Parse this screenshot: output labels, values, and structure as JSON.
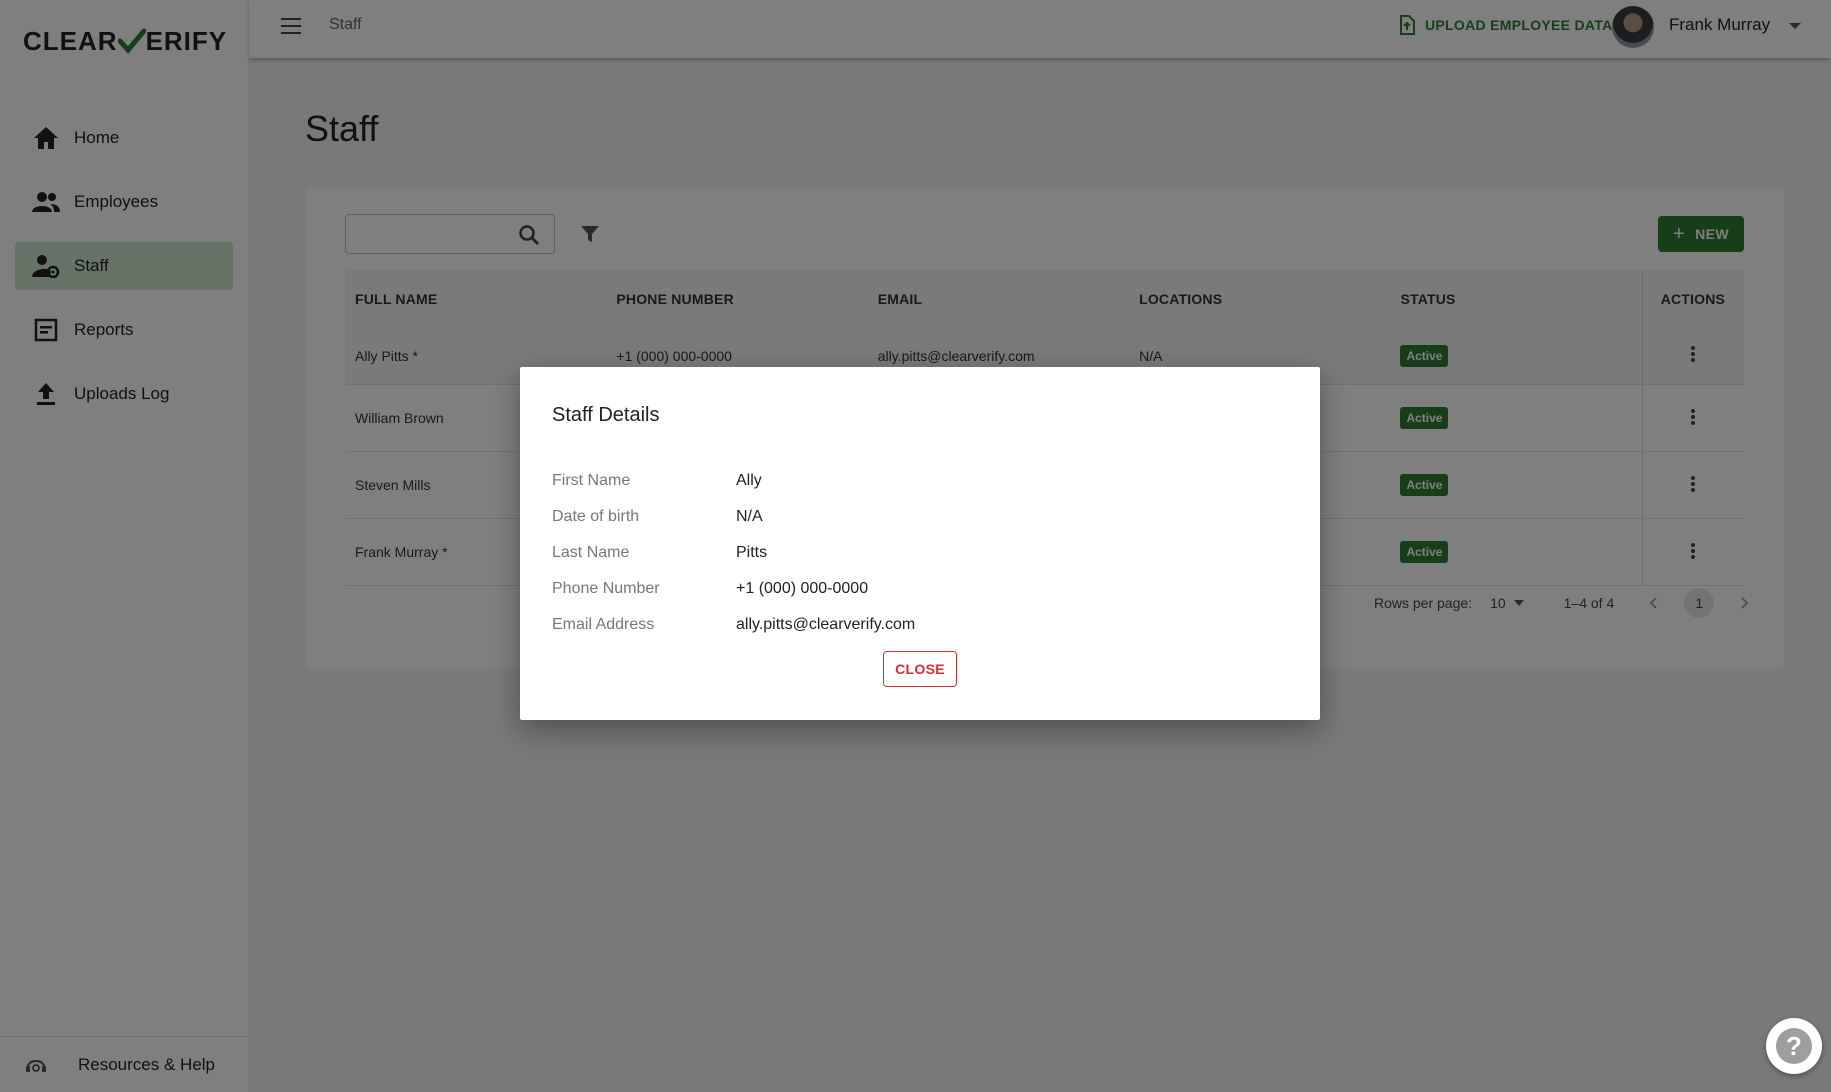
{
  "app": {
    "logo_left": "CLEAR",
    "logo_right": "ERIFY"
  },
  "sidebar": {
    "items": [
      {
        "label": "Home",
        "icon": "home-icon"
      },
      {
        "label": "Employees",
        "icon": "people-icon"
      },
      {
        "label": "Staff",
        "icon": "staff-settings-icon",
        "active": true
      },
      {
        "label": "Reports",
        "icon": "report-icon"
      },
      {
        "label": "Uploads Log",
        "icon": "upload-icon"
      }
    ],
    "footer": {
      "label": "Resources & Help",
      "icon": "support-agent-icon"
    }
  },
  "topbar": {
    "breadcrumb": "Staff",
    "upload_label": "UPLOAD EMPLOYEE DATA",
    "user_name": "Frank Murray"
  },
  "main": {
    "title": "Staff",
    "search": {
      "placeholder": "",
      "value": ""
    },
    "new_label": "NEW",
    "table": {
      "headers": [
        "FULL NAME",
        "PHONE NUMBER",
        "EMAIL",
        "LOCATIONS",
        "STATUS",
        "ACTIONS"
      ],
      "rows": [
        {
          "name": "Ally Pitts *",
          "phone": "+1 (000) 000-0000",
          "email": "ally.pitts@clearverify.com",
          "locations": "N/A",
          "status": "Active"
        },
        {
          "name": "William Brown",
          "phone": "",
          "email": "",
          "locations": "",
          "status": "Active"
        },
        {
          "name": "Steven Mills",
          "phone": "",
          "email": "",
          "locations": "",
          "status": "Active"
        },
        {
          "name": "Frank Murray *",
          "phone": "",
          "email": "",
          "locations": "",
          "status": "Active"
        }
      ]
    },
    "pagination": {
      "rows_per_page_label": "Rows per page:",
      "rows_per_page": "10",
      "range": "1–4 of 4",
      "page": "1"
    }
  },
  "dialog": {
    "title": "Staff Details",
    "fields": [
      {
        "label": "First Name",
        "value": "Ally"
      },
      {
        "label": "Date of birth",
        "value": "N/A"
      },
      {
        "label": "Last Name",
        "value": "Pitts"
      },
      {
        "label": "Phone Number",
        "value": "+1 (000) 000-0000"
      },
      {
        "label": "Email Address",
        "value": "ally.pitts@clearverify.com"
      }
    ],
    "close_label": "CLOSE"
  },
  "colors": {
    "brand_green": "#2e7d32",
    "active_nav": "#cfe6cf",
    "danger": "#d32f2f"
  }
}
